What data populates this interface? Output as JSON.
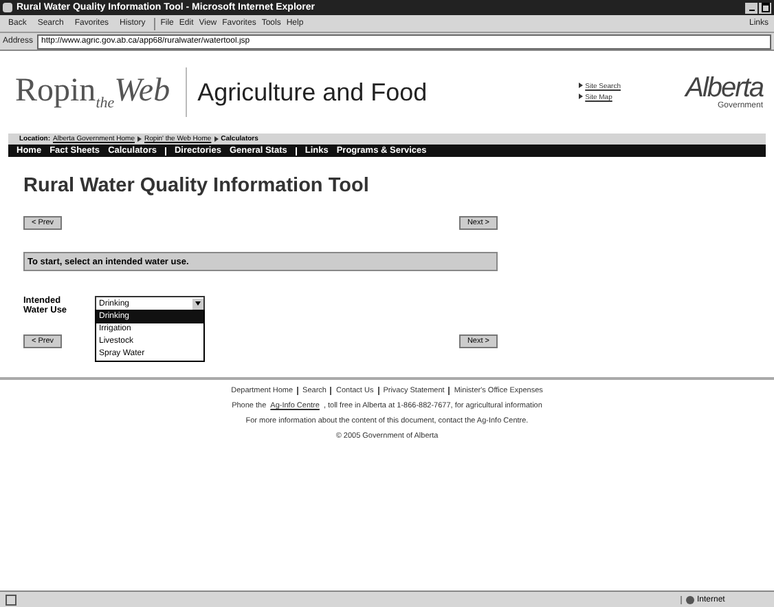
{
  "window": {
    "title": "Rural Water Quality Information Tool - Microsoft Internet Explorer"
  },
  "toolbar": {
    "buttons": [
      "Back",
      "Search",
      "Favorites",
      "History"
    ],
    "menus": [
      "File",
      "Edit",
      "View",
      "Favorites",
      "Tools",
      "Help"
    ],
    "links": "Links"
  },
  "address": {
    "label": "Address",
    "value": "http://www.agric.gov.ab.ca/app68/ruralwater/watertool.jsp"
  },
  "header": {
    "logo": {
      "first": "Ropin",
      "middle": "the",
      "last": "Web"
    },
    "title": "Agriculture and Food",
    "links": [
      "Site Search",
      "Site Map"
    ],
    "gov_logo": {
      "name": "Alberta",
      "sub": "Government"
    }
  },
  "location": {
    "label": "Location:",
    "crumbs": [
      {
        "text": "Alberta Government Home",
        "link": true
      },
      {
        "text": "Ropin' the Web Home",
        "link": true
      },
      {
        "text": "Calculators",
        "link": false
      }
    ]
  },
  "nav": [
    {
      "label": "Home",
      "separator": false
    },
    {
      "label": "Fact Sheets",
      "separator": false
    },
    {
      "label": "Calculators",
      "separator": true
    },
    {
      "label": "Directories",
      "separator": false
    },
    {
      "label": "General Stats",
      "separator": true
    },
    {
      "label": "Links",
      "separator": false
    },
    {
      "label": "Programs & Services",
      "separator": false
    }
  ],
  "page": {
    "heading": "Rural Water Quality Information Tool",
    "prev_top": "< Prev",
    "next_top": "Next >",
    "message": "To start, select an intended water use.",
    "field_label": "Intended Water Use",
    "select_value": "Drinking",
    "options": [
      {
        "label": "Drinking",
        "selected": true
      },
      {
        "label": "Irrigation",
        "selected": false
      },
      {
        "label": "Livestock",
        "selected": false
      },
      {
        "label": "Spray Water",
        "selected": false
      }
    ],
    "prev_bottom": "< Prev",
    "next_bottom": "Next >"
  },
  "footer": {
    "links": [
      "Department Home",
      "Search",
      "Contact Us",
      "Privacy Statement",
      "Minister's Office Expenses"
    ],
    "phone": {
      "before": "Phone the ",
      "link": "Ag-Info Centre",
      "after": ", toll free in Alberta at 1-866-882-7677, for agricultural information"
    },
    "contact": "For more information about the content of this document, contact the Ag-Info Centre.",
    "copyright": "© 2005 Government of Alberta"
  },
  "status_bar": {
    "zone": "Internet"
  }
}
